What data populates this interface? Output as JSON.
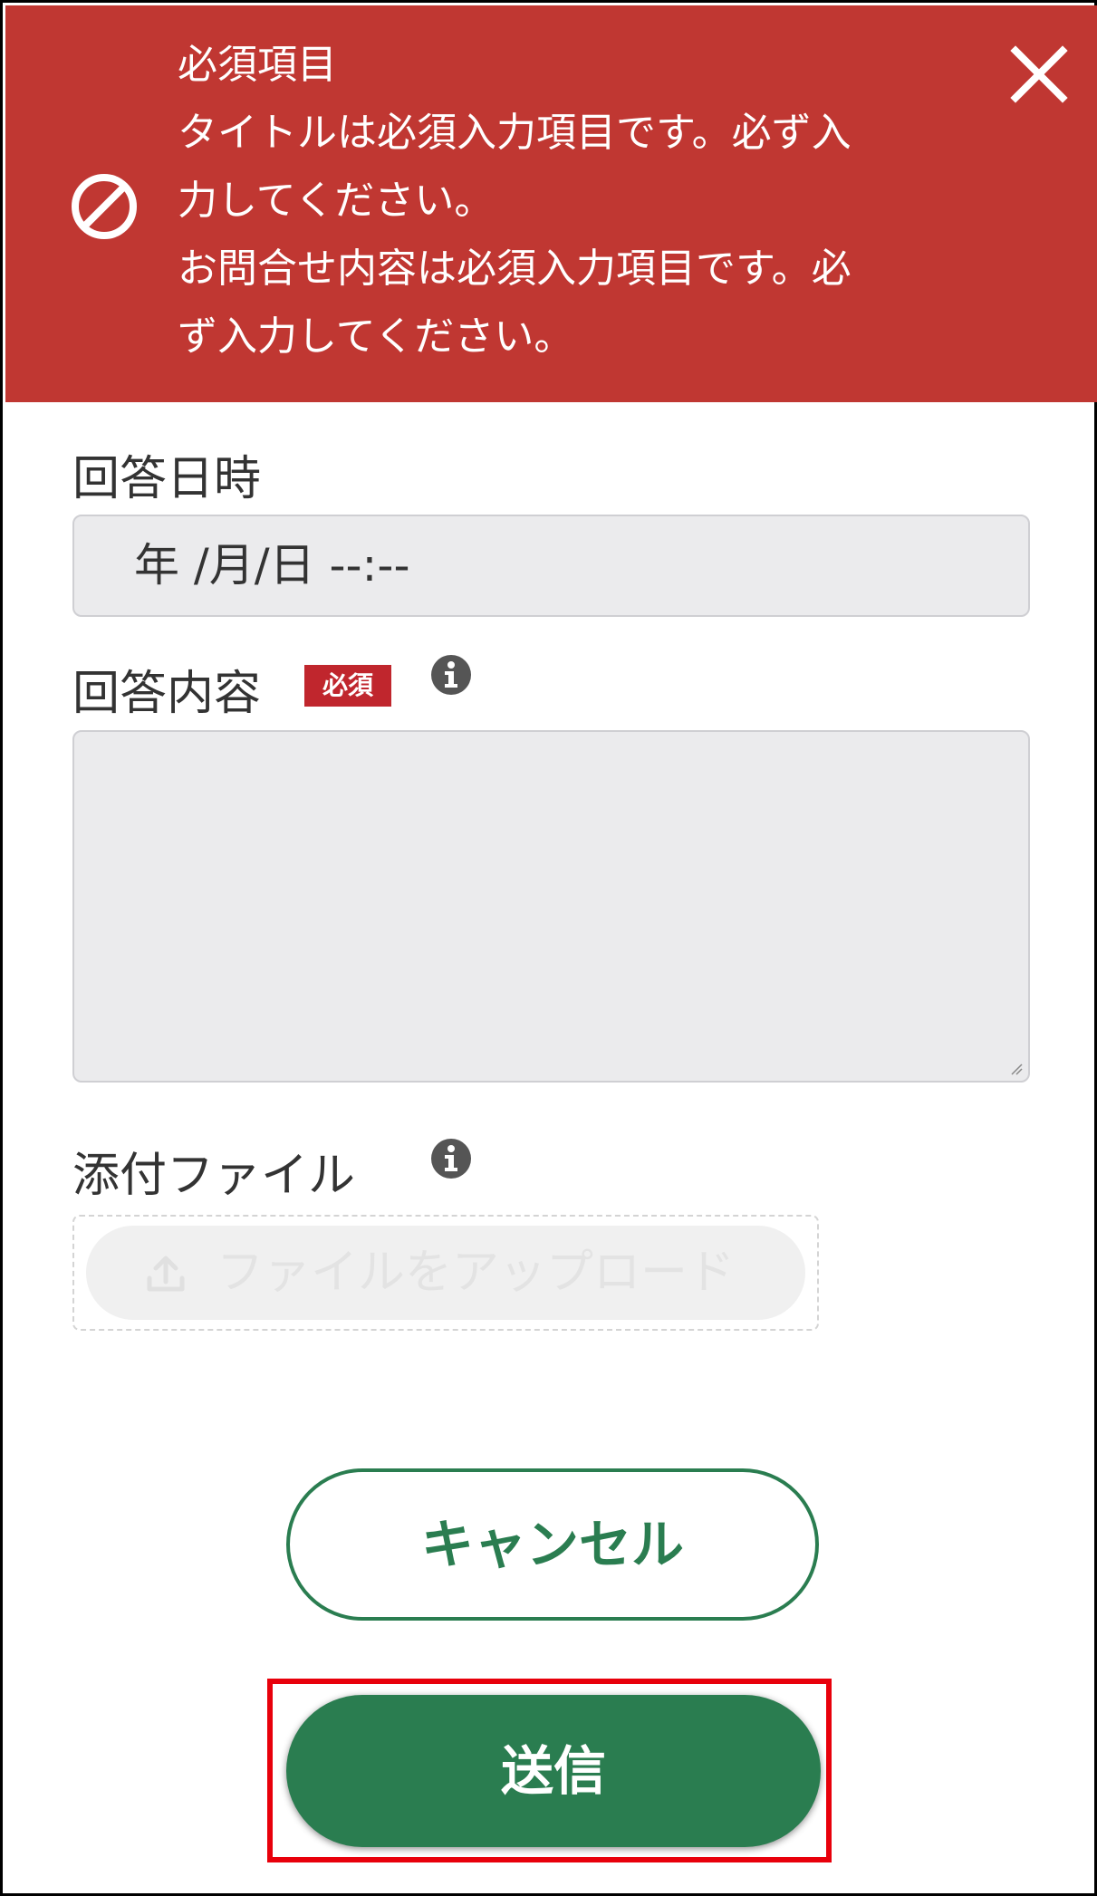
{
  "colors": {
    "banner_background": "#c03732",
    "accent_green": "#2a7d50",
    "required_badge": "#c0262d",
    "highlight_outline": "#e8000b"
  },
  "error_banner": {
    "icon": "prohibited-icon",
    "close_icon": "close-icon",
    "lines": [
      "必須項目",
      "タイトルは必須入力項目です。必ず入",
      "力してください。",
      "お問合せ内容は必須入力項目です。必",
      "ず入力してください。"
    ]
  },
  "form": {
    "response_datetime": {
      "label": "回答日時",
      "value": "年 /月/日 --:--"
    },
    "response_content": {
      "label": "回答内容",
      "required_badge": "必須",
      "info_icon": "info-icon",
      "value": ""
    },
    "attachment": {
      "label": "添付ファイル",
      "info_icon": "info-icon",
      "upload_icon": "upload-icon",
      "upload_label": "ファイルをアップロード"
    }
  },
  "buttons": {
    "cancel": "キャンセル",
    "submit": "送信"
  }
}
